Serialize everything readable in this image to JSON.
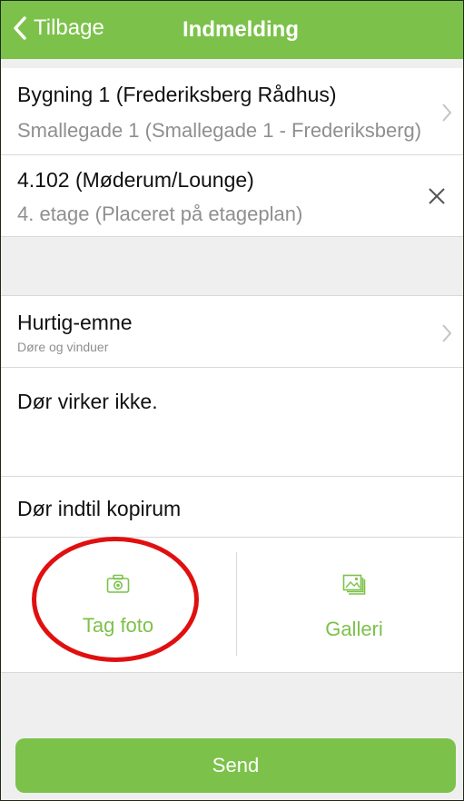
{
  "nav": {
    "back_label": "Tilbage",
    "title": "Indmelding"
  },
  "building": {
    "name": "Bygning 1 (Frederiksberg Rådhus)",
    "address": "Smallegade 1 (Smallegade 1 - Frederiksberg)"
  },
  "room": {
    "name": "4.102  (Møderum/Lounge)",
    "floor": "4. etage (Placeret på etageplan)"
  },
  "quick_topic": {
    "label": "Hurtig-emne",
    "value": "Døre og vinduer"
  },
  "description": {
    "value": "Dør virker ikke."
  },
  "location_note": {
    "value": "Dør indtil kopirum"
  },
  "photo": {
    "take_label": "Tag foto",
    "gallery_label": "Galleri"
  },
  "send_label": "Send",
  "colors": {
    "accent": "#7cc24a",
    "annotation": "#e01010"
  }
}
